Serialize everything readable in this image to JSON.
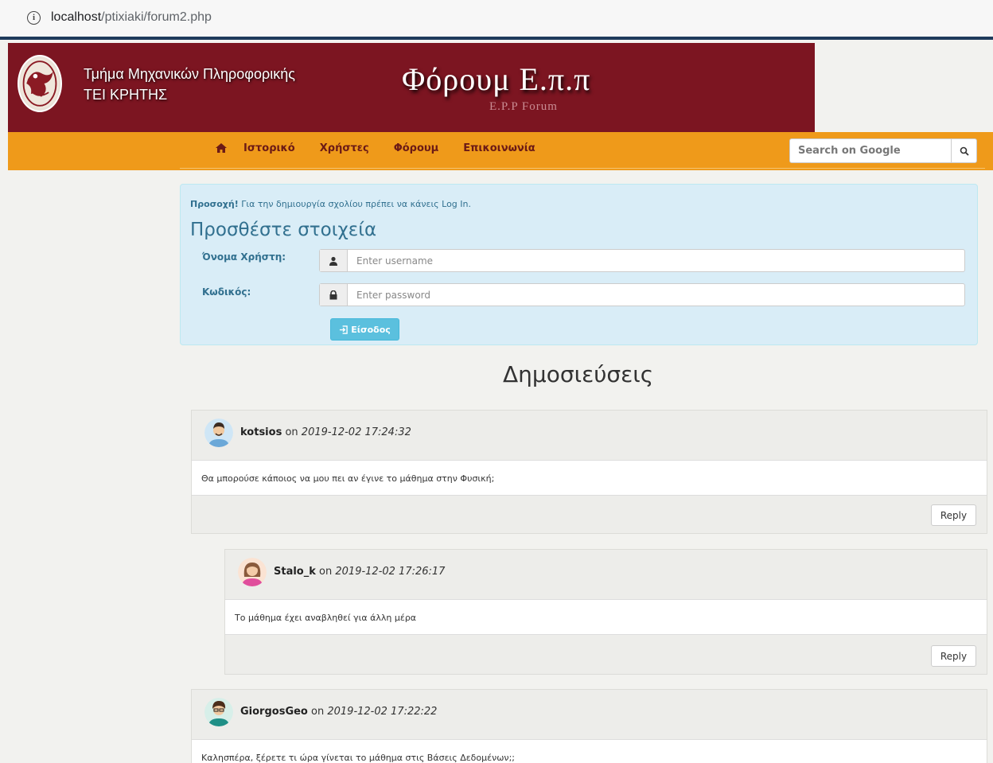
{
  "browser": {
    "url_host": "localhost",
    "url_path": "/ptixiaki/forum2.php"
  },
  "header": {
    "dept_line1": "Τμήμα Μηχανικών Πληροφορικής",
    "dept_line2": "ΤΕΙ ΚΡΗΤΗΣ",
    "title": "Φόρουμ Ε.π.π",
    "subtitle": "E.P.P Forum"
  },
  "nav": {
    "home_icon": "home-icon",
    "items": [
      {
        "label": "Ιστορικό"
      },
      {
        "label": "Χρήστες"
      },
      {
        "label": "Φόρουμ"
      },
      {
        "label": "Επικοινωνία"
      }
    ],
    "search_placeholder": "Search on Google",
    "search_icon": "search-icon"
  },
  "login": {
    "warning_strong": "Προσοχή!",
    "warning_text": " Για την δημιουργία σχολίου πρέπει να κάνεις Log In.",
    "title": "Προσθέστε στοιχεία",
    "username_label": "Όνομα Χρήστη:",
    "username_placeholder": "Enter username",
    "password_label": "Κωδικός:",
    "password_placeholder": "Enter password",
    "submit_label": "Είσοδος"
  },
  "posts_title": "Δημοσιεύσεις",
  "posts": [
    {
      "author": "kotsios",
      "on": "on",
      "date": "2019-12-02 17:24:32",
      "text": "Θα μπορούσε κάποιος να μου πει αν έγινε το μάθημα στην Φυσική;",
      "reply_label": "Reply"
    },
    {
      "author": "Stalo_k",
      "on": "on",
      "date": "2019-12-02 17:26:17",
      "text": "Το μάθημα έχει αναβληθεί για άλλη μέρα",
      "reply_label": "Reply"
    },
    {
      "author": "GiorgosGeo",
      "on": "on",
      "date": "2019-12-02 17:22:22",
      "text": "Καλησπέρα, ξέρετε τι ώρα γίνεται το μάθημα στις Βάσεις Δεδομένων;;"
    }
  ],
  "colors": {
    "header_bg": "#7c1521",
    "navbar_bg": "#ef9a1a",
    "nav_text": "#6b1a16",
    "alert_bg": "#d9edf7",
    "alert_text": "#31708f",
    "button_info": "#5bc0de"
  }
}
